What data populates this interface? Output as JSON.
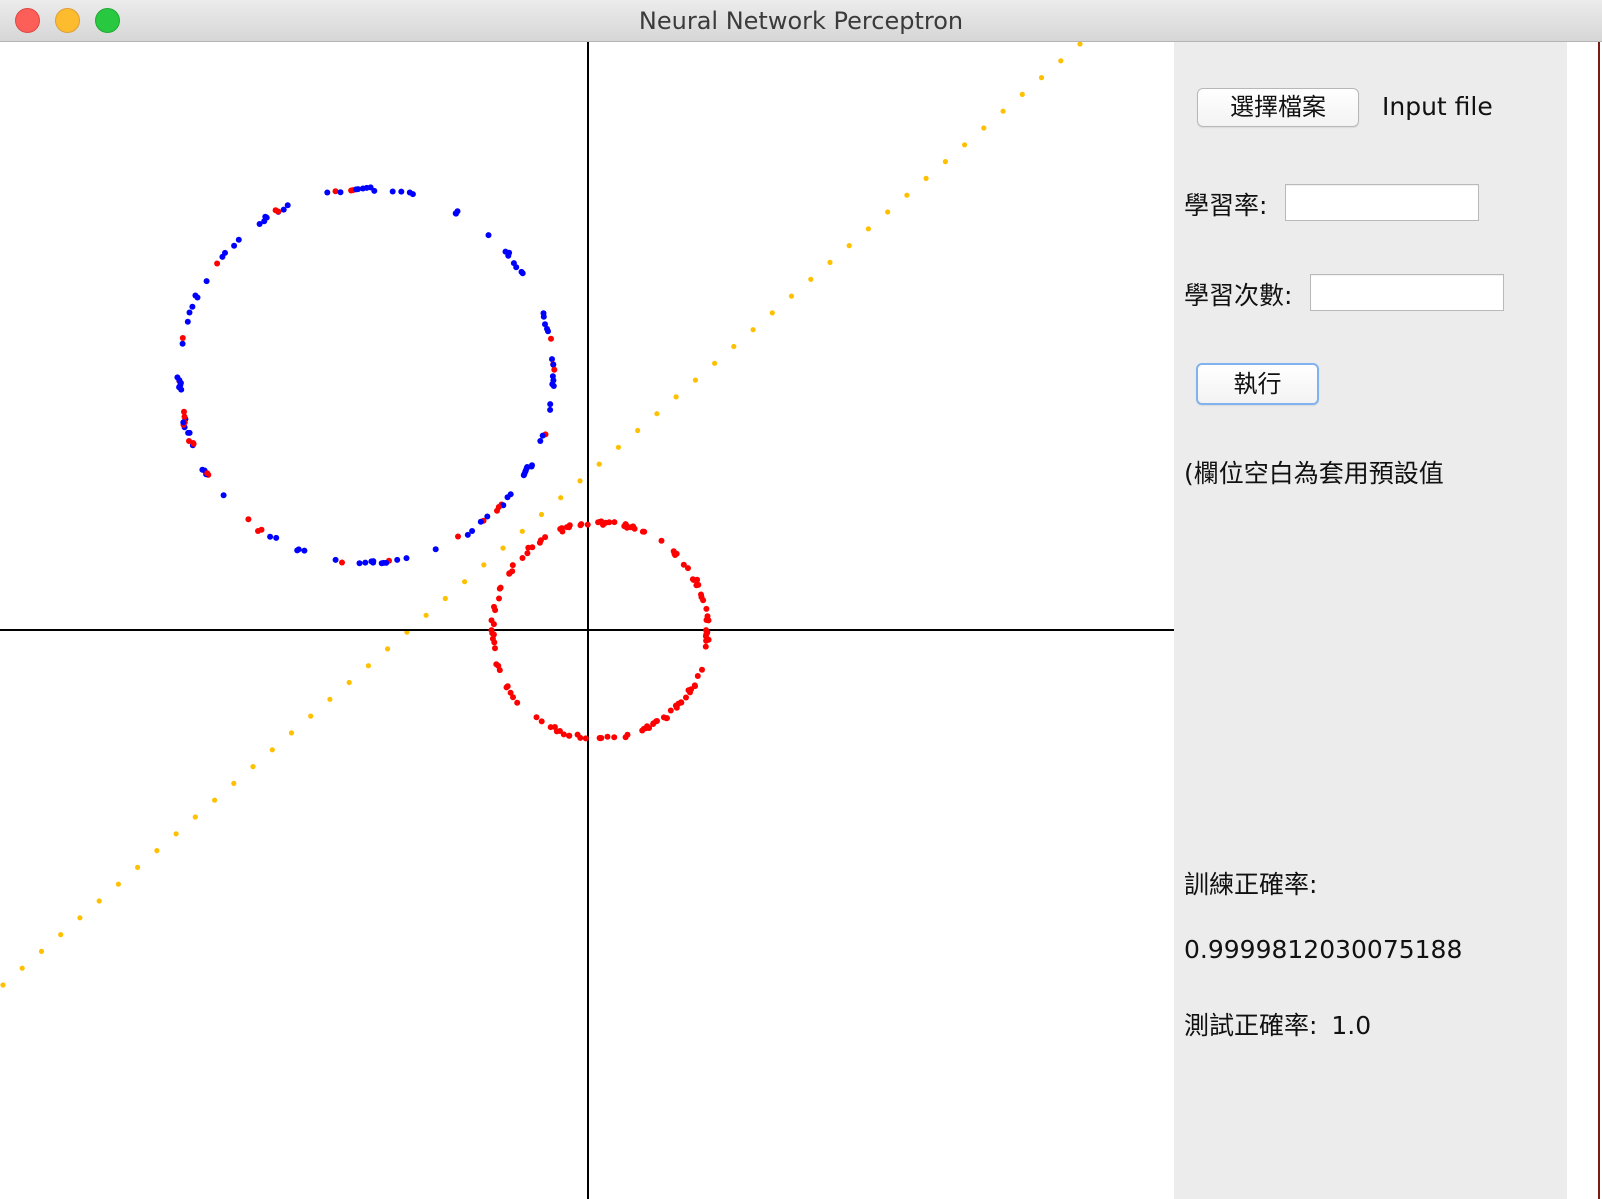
{
  "window": {
    "title": "Neural Network Perceptron"
  },
  "panel": {
    "choose_file_label": "選擇檔案",
    "input_file_text": "Input file",
    "learning_rate_label": "學習率:",
    "learning_rate_value": "",
    "iterations_label": "學習次數:",
    "iterations_value": "",
    "run_label": "執行",
    "default_note": "(欄位空白為套用預設值",
    "train_accuracy_label": "訓練正確率:",
    "train_accuracy_value": "0.9999812030075188",
    "test_accuracy_label": "測試正確率:",
    "test_accuracy_value": "1.0"
  },
  "colors": {
    "class_a": "#0000ff",
    "class_b": "#ff0000",
    "decision_line": "#ffc000",
    "axes": "#000000"
  }
}
